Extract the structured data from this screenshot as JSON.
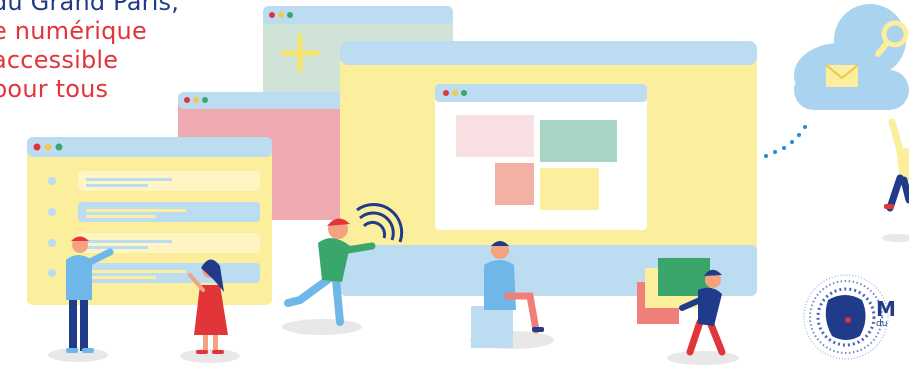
{
  "tagline": {
    "line1": "du Grand Paris,",
    "line2": "e numérique",
    "line3": "accessible",
    "line4": "pour tous"
  },
  "logo": {
    "initial": "M",
    "subtitle": "du"
  },
  "colors": {
    "navy": "#1f3b8a",
    "red": "#e2353a",
    "window_bar_blue": "#bcdcf2",
    "window_yellow": "#fbee9c",
    "window_pink": "#eeaab0",
    "window_mint": "#cfe3d6",
    "cloud_blue": "#a9d3ef"
  },
  "icons": [
    "plus-icon",
    "mail-icon",
    "magnifier-icon",
    "touch-wave-icon",
    "cloud-icon"
  ]
}
